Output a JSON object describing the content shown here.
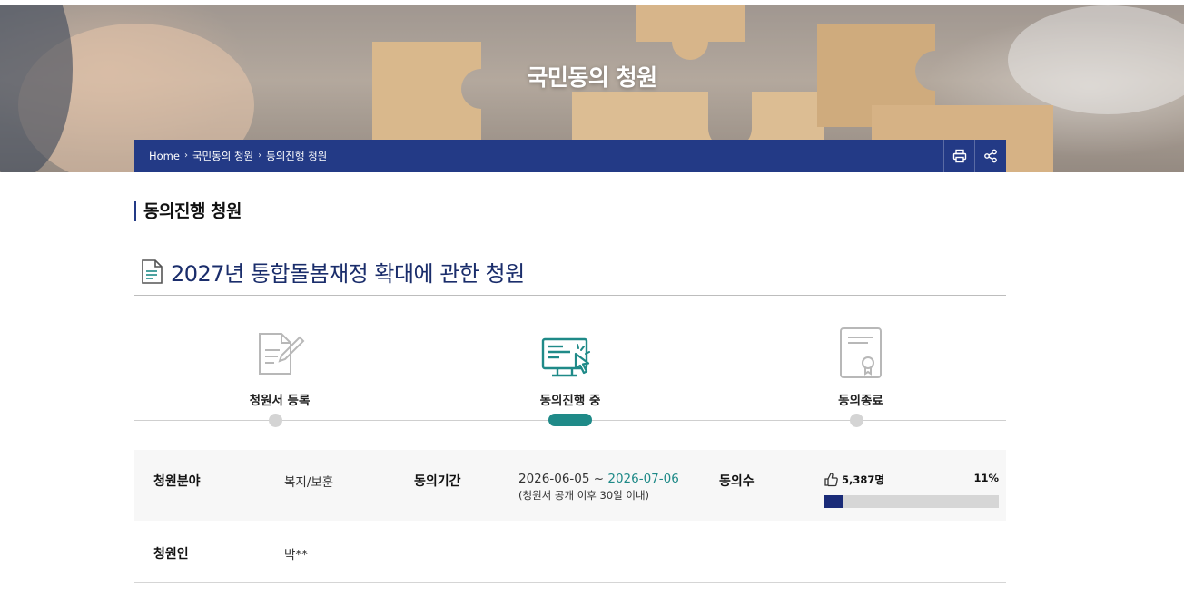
{
  "banner": {
    "title": "국민동의 청원"
  },
  "breadcrumb": {
    "items": [
      "Home",
      "국민동의 청원",
      "동의진행 청원"
    ],
    "separator": "›"
  },
  "toolbar": {
    "print_icon": "printer-icon",
    "share_icon": "share-icon"
  },
  "section": {
    "title": "동의진행 청원"
  },
  "petition": {
    "title": "2027년 통합돌봄재정 확대에 관한 청원",
    "title_icon": "document-icon"
  },
  "steps": [
    {
      "label": "청원서 등록",
      "icon": "document-pen-icon",
      "active": false
    },
    {
      "label": "동의진행 중",
      "icon": "monitor-click-icon",
      "active": true
    },
    {
      "label": "동의종료",
      "icon": "certificate-icon",
      "active": false
    }
  ],
  "info": {
    "category_label": "청원분야",
    "category_value": "복지/보훈",
    "period_label": "동의기간",
    "period_start": "2026-06-05 ~ ",
    "period_end": "2026-07-06",
    "period_note": "(청원서 공개 이후 30일 이내)",
    "consent_label": "동의수",
    "consent_count": "5,387명",
    "consent_percent": "11%",
    "consent_fraction": 0.11,
    "petitioner_label": "청원인",
    "petitioner_value": "박**"
  },
  "colors": {
    "brand_navy": "#233a86",
    "accent_teal": "#1f8a88",
    "progress": "#1a2b78"
  }
}
